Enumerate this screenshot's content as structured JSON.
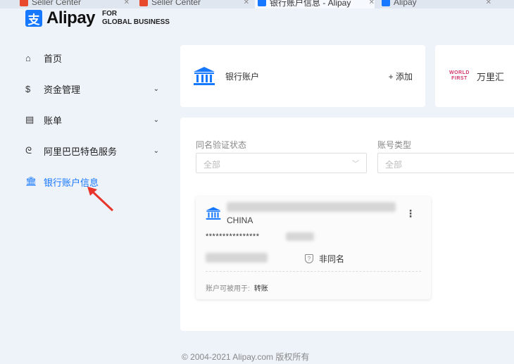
{
  "browser_tabs": [
    {
      "label": "Seller Center",
      "color": "#e8492c"
    },
    {
      "label": "Seller Center",
      "color": "#e8492c"
    },
    {
      "label": "银行账户信息 - Alipay",
      "color": "#1677ff",
      "active": true
    },
    {
      "label": "Alipay",
      "color": "#1677ff"
    }
  ],
  "logo": {
    "mark": "支",
    "name": "Alipay",
    "sub1": "FOR",
    "sub2": "GLOBAL BUSINESS"
  },
  "nav": [
    {
      "icon": "⌂",
      "label": "首页",
      "chev": ""
    },
    {
      "icon": "$",
      "label": "资金管理",
      "chev": "⌄"
    },
    {
      "icon": "▤",
      "label": "账单",
      "chev": "⌄"
    },
    {
      "icon": "ᘓ",
      "label": "阿里巴巴特色服务",
      "chev": "⌄"
    },
    {
      "icon": "🏛",
      "label": "银行账户信息",
      "chev": ""
    }
  ],
  "bank_card": {
    "label": "银行账户",
    "add": "+  添加"
  },
  "worldfirst": {
    "logo1": "WORLD",
    "logo2": "FIRST",
    "name": "万里汇"
  },
  "filters": {
    "verify_label": "同名验证状态",
    "verify_value": "全部",
    "type_label": "账号类型",
    "type_value": "全部"
  },
  "account": {
    "country": "CHINA",
    "masked": "****************",
    "status": "非同名",
    "usage_label": "账户可被用于:",
    "usage_value": "转账",
    "more": "⋮"
  },
  "footer": "© 2004-2021 Alipay.com 版权所有",
  "colors": {
    "accent": "#1677ff",
    "bg": "#eef3fa"
  }
}
